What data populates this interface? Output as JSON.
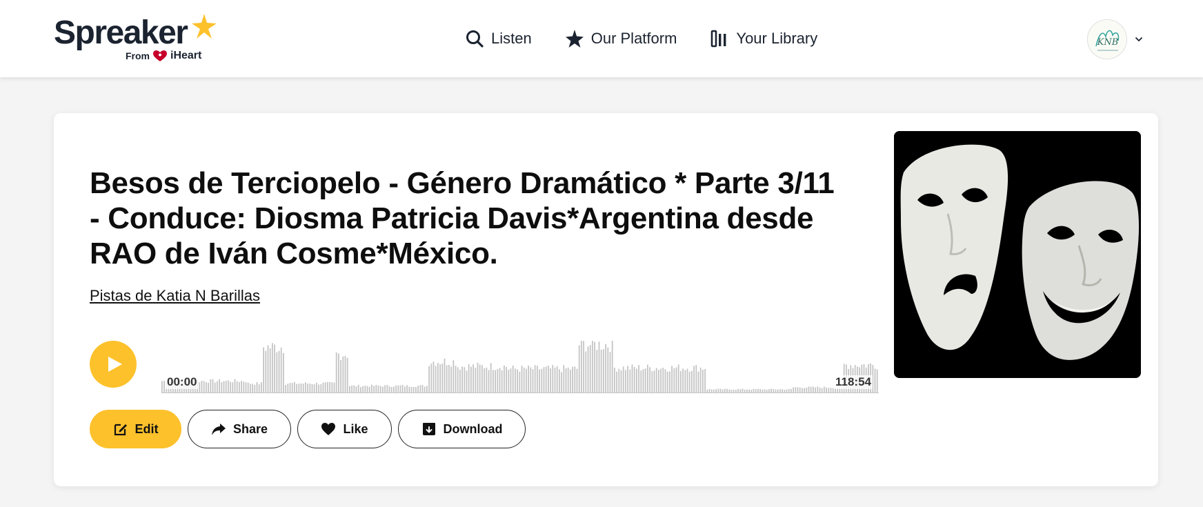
{
  "header": {
    "logo": {
      "word": "Spreaker",
      "from": "From",
      "brand": "iHeart"
    },
    "nav": [
      {
        "label": "Listen",
        "icon": "search-icon"
      },
      {
        "label": "Our Platform",
        "icon": "star-icon"
      },
      {
        "label": "Your Library",
        "icon": "library-icon"
      }
    ],
    "user": {
      "avatar_text": "KNB"
    }
  },
  "episode": {
    "title": "Besos de Terciopelo - Género Dramático * Parte 3/11 - Conduce: Diosma Patricia Davis*Argentina desde RAO de Iván Cosme*México.",
    "author": "Pistas de Katia N Barillas",
    "time_start": "00:00",
    "time_end": "118:54"
  },
  "actions": {
    "edit": "Edit",
    "share": "Share",
    "like": "Like",
    "download": "Download"
  },
  "colors": {
    "accent": "#fdc12c",
    "waveform": "#c4c4c4",
    "text": "#111111"
  }
}
